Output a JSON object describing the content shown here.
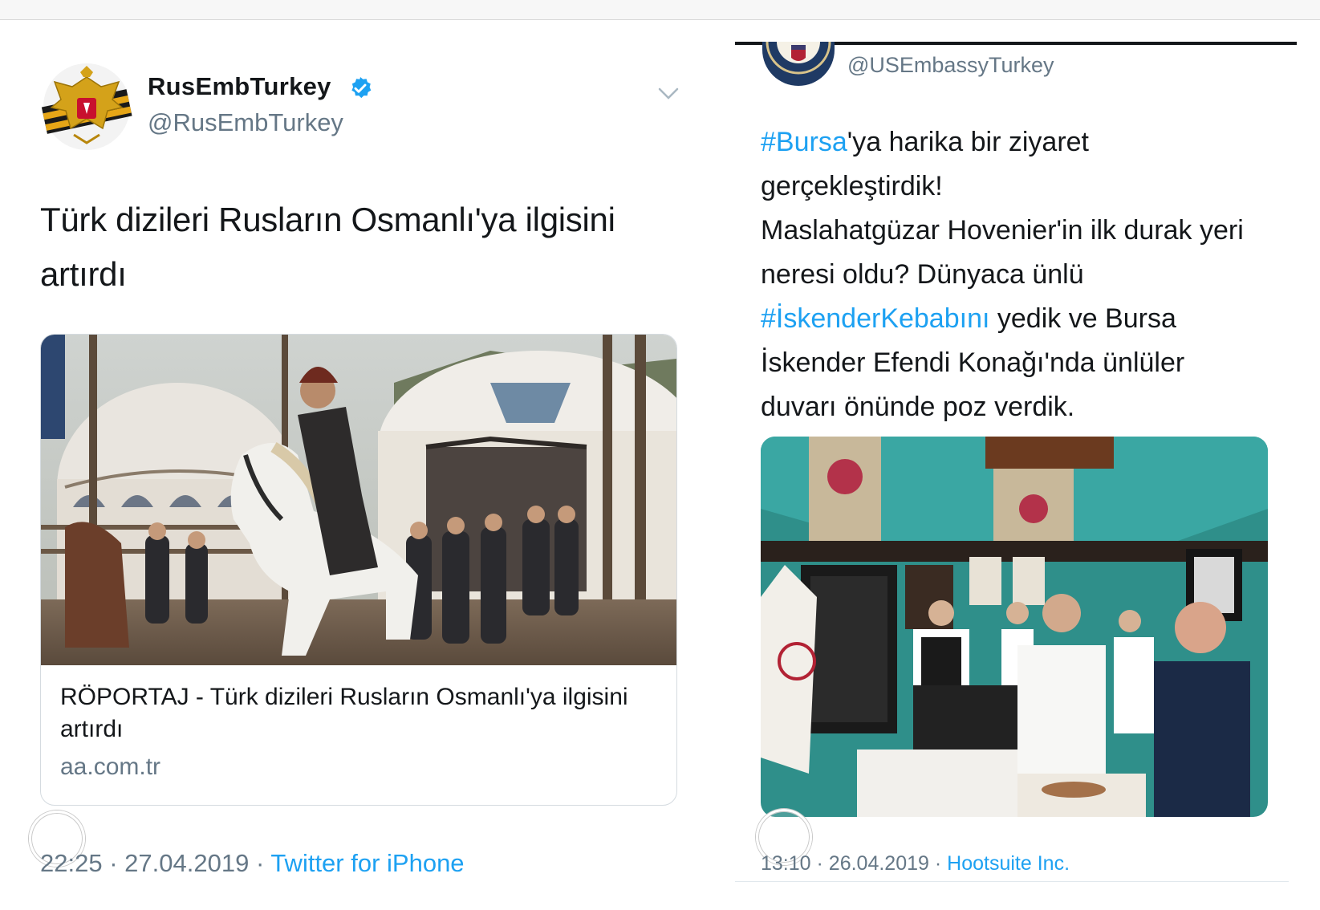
{
  "left_tweet": {
    "display_name": "RusEmbTurkey",
    "handle": "@RusEmbTurkey",
    "verified_icon": "verified-badge-icon",
    "menu_icon": "chevron-down-icon",
    "text": "Türk dizileri Rusların Osmanlı'ya ilgisini artırdı",
    "card": {
      "title": "RÖPORTAJ - Türk dizileri Rusların Osmanlı'ya ilgisini artırdı",
      "domain": "aa.com.tr",
      "image": "photo-horseman-tents"
    },
    "time": "22:25",
    "date": "27.04.2019",
    "separator": "·",
    "source": "Twitter for iPhone"
  },
  "right_tweet": {
    "handle": "@USEmbassyTurkey",
    "avatar": "us-embassy-seal",
    "text": {
      "hashtag1": "#Bursa",
      "line1_rest": "'ya harika bir ziyaret",
      "line2": "gerçekleştirdik!",
      "line3": "Maslahatgüzar Hovenier'in ilk durak yeri",
      "line4": "neresi oldu?  Dünyaca ünlü",
      "hashtag2": "#İskenderKebabını",
      "line5_rest": " yedik ve Bursa",
      "line6": "İskender Efendi Konağı'nda ünlüler",
      "line7": "duvarı önünde poz verdik."
    },
    "image": "photo-restaurant-wax-figures",
    "time": "13:10",
    "date": "26.04.2019",
    "separator": "·",
    "source": "Hootsuite Inc."
  },
  "colors": {
    "link_blue": "#1da1f2",
    "text_dark": "#14171a",
    "text_gray": "#657786"
  }
}
